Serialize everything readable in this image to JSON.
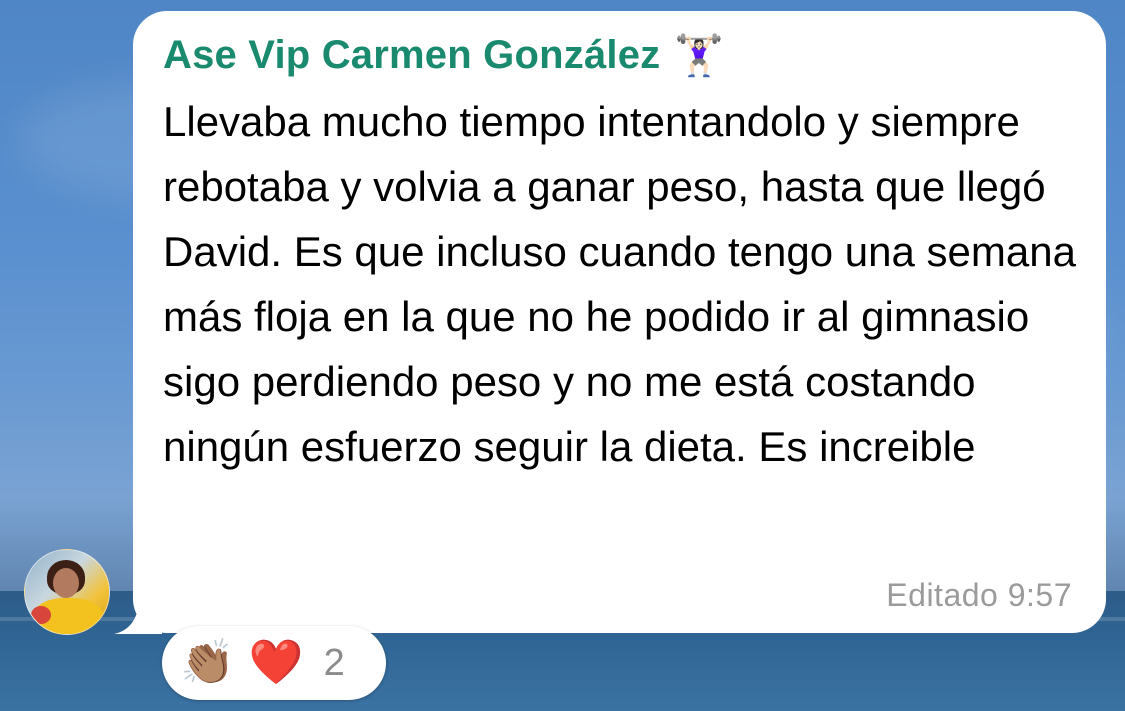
{
  "message": {
    "sender_name": "Ase Vip Carmen González",
    "sender_emoji": "🏋🏻‍♀️",
    "text": "Llevaba mucho tiempo intentandolo y siempre rebotaba y volvia a ganar peso, hasta que llegó David. Es que incluso cuando tengo una semana más floja en la que no he podido ir al gimnasio sigo perdiendo peso y no me está costando ningún esfuerzo seguir la dieta. Es increible",
    "meta": "Editado 9:57"
  },
  "reactions": {
    "emojis": [
      "👏🏽",
      "❤️"
    ],
    "count": "2"
  },
  "colors": {
    "sender_name": "#1a8a6f",
    "bubble": "#ffffff",
    "meta_text": "#9b9b9b"
  },
  "icons": {
    "avatar": "profile-photo"
  }
}
